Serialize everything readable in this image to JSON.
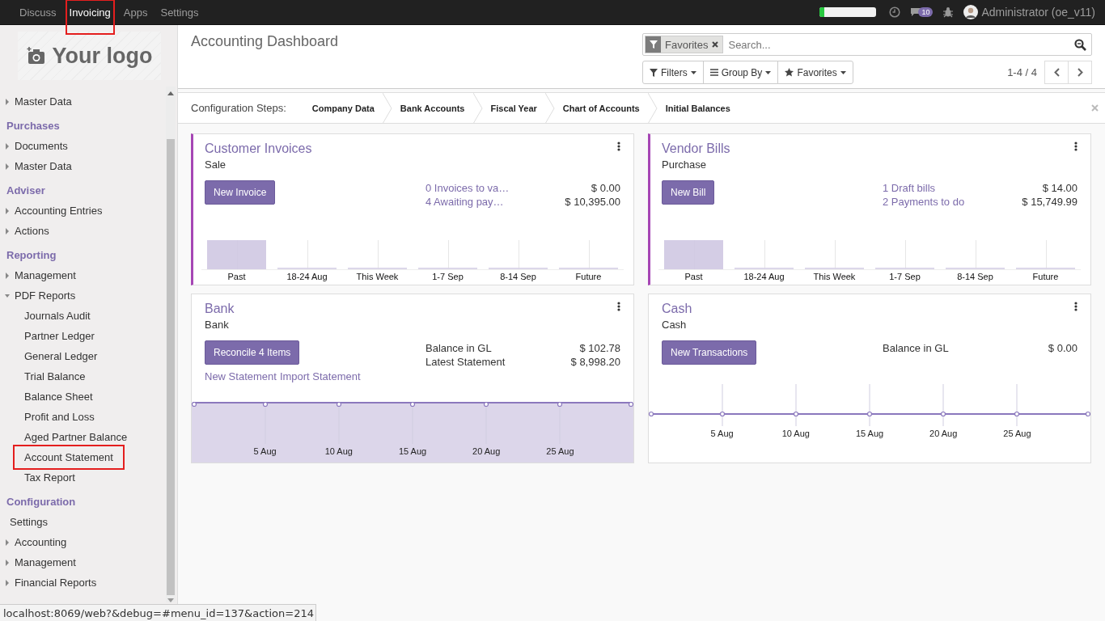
{
  "topbar": {
    "menus": [
      {
        "label": "Discuss",
        "selected": false,
        "highlighted": false
      },
      {
        "label": "Invoicing",
        "selected": true,
        "highlighted": true
      },
      {
        "label": "Apps",
        "selected": false,
        "highlighted": false
      },
      {
        "label": "Settings",
        "selected": false,
        "highlighted": false
      }
    ],
    "progress": {
      "level": 0.08
    },
    "messages_badge": "10",
    "user": "Administrator (oe_v11)"
  },
  "sidebar": {
    "logo": "Your logo",
    "sections": [
      {
        "items": [
          {
            "label": "Master Data",
            "kind": "folder",
            "expanded": false,
            "highlighted": false
          }
        ]
      },
      {
        "heading": "Purchases",
        "items": [
          {
            "label": "Documents",
            "kind": "folder",
            "expanded": false,
            "highlighted": false
          },
          {
            "label": "Master Data",
            "kind": "folder",
            "expanded": false,
            "highlighted": false
          }
        ]
      },
      {
        "heading": "Adviser",
        "items": [
          {
            "label": "Accounting Entries",
            "kind": "folder",
            "expanded": false,
            "highlighted": false
          },
          {
            "label": "Actions",
            "kind": "folder",
            "expanded": false,
            "highlighted": false
          }
        ]
      },
      {
        "heading": "Reporting",
        "items": [
          {
            "label": "Management",
            "kind": "folder",
            "expanded": false,
            "highlighted": false
          },
          {
            "label": "PDF Reports",
            "kind": "folder",
            "expanded": true,
            "highlighted": false,
            "children": [
              {
                "label": "Journals Audit",
                "highlighted": false
              },
              {
                "label": "Partner Ledger",
                "highlighted": false
              },
              {
                "label": "General Ledger",
                "highlighted": false
              },
              {
                "label": "Trial Balance",
                "highlighted": false
              },
              {
                "label": "Balance Sheet",
                "highlighted": false
              },
              {
                "label": "Profit and Loss",
                "highlighted": false
              },
              {
                "label": "Aged Partner Balance",
                "highlighted": false
              },
              {
                "label": "Account Statement",
                "highlighted": true
              },
              {
                "label": "Tax Report",
                "highlighted": false
              }
            ]
          }
        ]
      },
      {
        "heading": "Configuration",
        "items": [
          {
            "label": "Settings",
            "kind": "link",
            "highlighted": false
          },
          {
            "label": "Accounting",
            "kind": "folder",
            "expanded": false,
            "highlighted": false
          },
          {
            "label": "Management",
            "kind": "folder",
            "expanded": false,
            "highlighted": false
          },
          {
            "label": "Financial Reports",
            "kind": "folder",
            "expanded": false,
            "highlighted": false
          }
        ]
      }
    ]
  },
  "control_panel": {
    "title": "Accounting Dashboard",
    "search": {
      "facet": "Favorites",
      "placeholder": "Search..."
    },
    "buttons": [
      "Filters",
      "Group By",
      "Favorites"
    ],
    "pager": "1-4 / 4"
  },
  "config_steps": {
    "label": "Configuration Steps:",
    "steps": [
      "Company Data",
      "Bank Accounts",
      "Fiscal Year",
      "Chart of Accounts",
      "Initial Balances"
    ]
  },
  "cards": [
    {
      "title": "Customer Invoices",
      "subtitle": "Sale",
      "accent": true,
      "button": "New Invoice",
      "rows": [
        {
          "label": "0 Invoices to va…",
          "amount": "$ 0.00",
          "kind": "link"
        },
        {
          "label": "4 Awaiting pay…",
          "amount": "$ 10,395.00",
          "kind": "link"
        }
      ],
      "graph": {
        "kind": "bars",
        "labels": [
          "Past",
          "18-24 Aug",
          "This Week",
          "1-7 Sep",
          "8-14 Sep",
          "Future"
        ]
      }
    },
    {
      "title": "Vendor Bills",
      "subtitle": "Purchase",
      "accent": true,
      "button": "New Bill",
      "rows": [
        {
          "label": "1 Draft bills",
          "amount": "$ 14.00",
          "kind": "link"
        },
        {
          "label": "2 Payments to do",
          "amount": "$ 15,749.99",
          "kind": "link"
        }
      ],
      "graph": {
        "kind": "bars",
        "labels": [
          "Past",
          "18-24 Aug",
          "This Week",
          "1-7 Sep",
          "8-14 Sep",
          "Future"
        ]
      }
    },
    {
      "title": "Bank",
      "subtitle": "Bank",
      "accent": false,
      "button": "Reconcile 4 Items",
      "rows": [
        {
          "label": "Balance in GL",
          "amount": "$ 102.78",
          "kind": "text"
        },
        {
          "label": "Latest Statement",
          "amount": "$ 8,998.20",
          "kind": "text"
        }
      ],
      "links": [
        "New Statement",
        "Import Statement"
      ],
      "graph": {
        "kind": "area",
        "labels": [
          "5 Aug",
          "10 Aug",
          "15 Aug",
          "20 Aug",
          "25 Aug"
        ]
      }
    },
    {
      "title": "Cash",
      "subtitle": "Cash",
      "accent": false,
      "button": "New Transactions",
      "rows": [
        {
          "label": "Balance in GL",
          "amount": "$ 0.00",
          "kind": "text"
        }
      ],
      "graph": {
        "kind": "line",
        "labels": [
          "5 Aug",
          "10 Aug",
          "15 Aug",
          "20 Aug",
          "25 Aug"
        ]
      }
    }
  ],
  "status_bar": "localhost:8069/web?&debug=#menu_id=137&action=214"
}
